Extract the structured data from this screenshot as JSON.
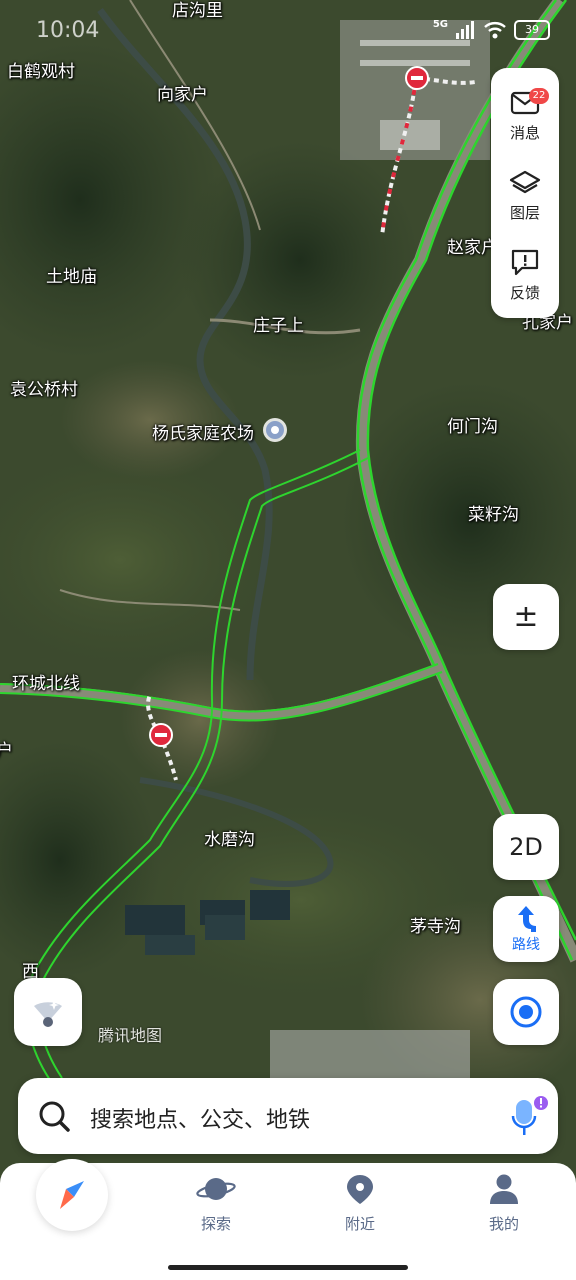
{
  "status_bar": {
    "time": "10:04",
    "network": "5G",
    "battery": "39"
  },
  "map": {
    "watermark": "腾讯地图",
    "place_labels": [
      "店沟里",
      "白鹤观村",
      "向家户",
      "赵家户",
      "土地庙",
      "庄子上",
      "孔家户",
      "袁公桥村",
      "杨氏家庭农场",
      "何门沟",
      "菜籽沟",
      "环城北线",
      "水磨沟",
      "茅寺沟",
      "西",
      "户"
    ]
  },
  "side_panel": {
    "messages_label": "消息",
    "messages_badge": "22",
    "layers_label": "图层",
    "feedback_label": "反馈"
  },
  "controls": {
    "zoom_label": "±",
    "view_mode_label": "2D",
    "route_label": "路线"
  },
  "search": {
    "placeholder": "搜索地点、公交、地铁"
  },
  "tabs": {
    "explore": "探索",
    "nearby": "附近",
    "mine": "我的"
  },
  "colors": {
    "accent": "#1a6ef5",
    "traffic_green": "#2ed52e",
    "closure_red": "#e0283c"
  }
}
